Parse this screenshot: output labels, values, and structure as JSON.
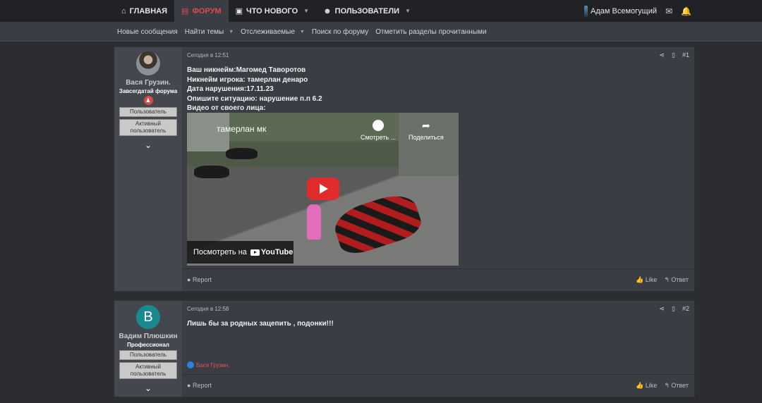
{
  "topnav": {
    "items": [
      {
        "label": "ГЛАВНАЯ",
        "icon": "home-icon",
        "glyph": "⌂",
        "active": false,
        "caret": false
      },
      {
        "label": "ФОРУМ",
        "icon": "forum-icon",
        "glyph": "▤",
        "active": true,
        "caret": false
      },
      {
        "label": "ЧТО НОВОГО",
        "icon": "whats-new-icon",
        "glyph": "▣",
        "active": false,
        "caret": true
      },
      {
        "label": "ПОЛЬЗОВАТЕЛИ",
        "icon": "users-icon",
        "glyph": "👥",
        "active": false,
        "caret": true
      }
    ],
    "user": "Адам Всемогущий"
  },
  "subnav": {
    "items": [
      {
        "label": "Новые сообщения",
        "caret": false
      },
      {
        "label": "Найти темы",
        "caret": true
      },
      {
        "label": "Отслеживаемые",
        "caret": true
      },
      {
        "label": "Поиск по форуму",
        "caret": false
      },
      {
        "label": "Отметить разделы прочитанными",
        "caret": false
      }
    ]
  },
  "posts": [
    {
      "author": "Вася Грузин.",
      "title": "Завсегдатай форума",
      "roles": [
        "Пользователь",
        "Активный пользователь"
      ],
      "time": "Сегодня в 12:51",
      "number": "#1",
      "lines": [
        "Ваш никнейм:Магомед Таворотов",
        "Никнейм игрока: тамерлан денаро",
        "Дата нарушения:17.11.23",
        "Опишите ситуацию: нарушение п.п 6.2",
        "Видео от своего лица:"
      ],
      "video": {
        "title": "тамерлан мк",
        "watch_later": "Смотреть ...",
        "share": "Поделиться",
        "watch_on": "Посмотреть на",
        "brand": "YouTube"
      },
      "report": "Report",
      "like": "Like",
      "reply": "Ответ"
    },
    {
      "author": "Вадим Плюшкин",
      "avatar_letter": "В",
      "title": "Профессионал",
      "roles": [
        "Пользователь",
        "Активный пользователь"
      ],
      "time": "Сегодня в 12:58",
      "number": "#2",
      "lines": [
        "Лишь бы за родных зацепить , подонки!!!"
      ],
      "reaction": "Вася Грузин.",
      "report": "Report",
      "like": "Like",
      "reply": "Ответ"
    }
  ],
  "colors": {
    "accent": "#e04b4b",
    "avatar_teal": "#1a8a8f"
  }
}
